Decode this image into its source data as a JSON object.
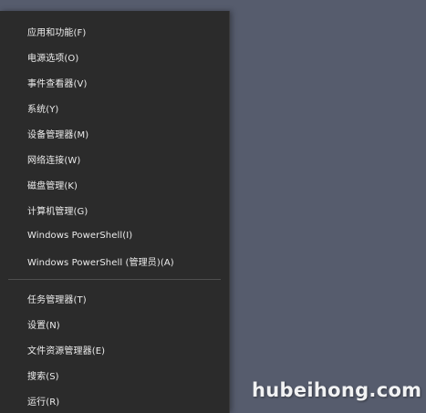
{
  "menu": {
    "group1": [
      {
        "label": "应用和功能(F)"
      },
      {
        "label": "电源选项(O)"
      },
      {
        "label": "事件查看器(V)"
      },
      {
        "label": "系统(Y)"
      },
      {
        "label": "设备管理器(M)"
      },
      {
        "label": "网络连接(W)"
      },
      {
        "label": "磁盘管理(K)"
      },
      {
        "label": "计算机管理(G)"
      },
      {
        "label": "Windows PowerShell(I)"
      },
      {
        "label": "Windows PowerShell (管理员)(A)"
      }
    ],
    "group2": [
      {
        "label": "任务管理器(T)"
      },
      {
        "label": "设置(N)"
      },
      {
        "label": "文件资源管理器(E)"
      },
      {
        "label": "搜索(S)"
      },
      {
        "label": "运行(R)"
      }
    ]
  },
  "watermark": "hubeihong.com",
  "colors": {
    "menu_background": "#2b2b2b",
    "menu_text": "#ececec",
    "desktop_background": "#565c6d"
  }
}
